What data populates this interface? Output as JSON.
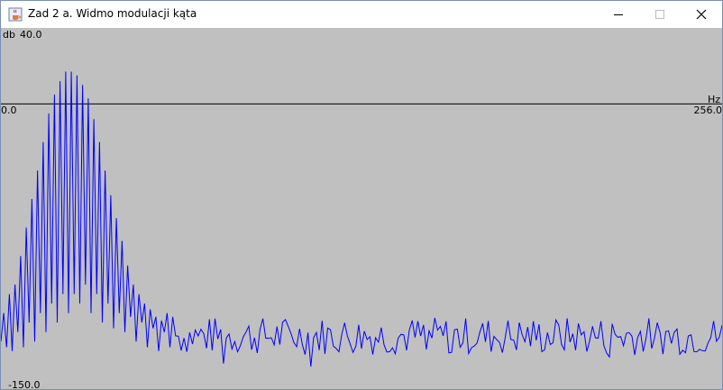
{
  "window": {
    "title": "Zad 2 a. Widmo modulacji kąta",
    "app_icon": "java-cup-icon",
    "controls": [
      "minimize-icon",
      "maximize-icon",
      "close-icon"
    ]
  },
  "chart_data": {
    "type": "line",
    "title": "",
    "ylabel": "db",
    "xlabel": "Hz",
    "y_max_label": "40.0",
    "y_min_label": "-150.0",
    "x_min_label": "0.0",
    "x_max_label": "256.0",
    "xlim": [
      0,
      256
    ],
    "ylim": [
      -150,
      40
    ],
    "grid": false,
    "line_color": "#0000ff",
    "background_color": "#c0c0c0",
    "envelope": {
      "lobe_start_hz": 0,
      "lobe_end_hz": 62,
      "peak_db": 17,
      "trough_db": -125,
      "noise_floor_db": -122,
      "noise_range_db": [
        -132,
        -112
      ]
    },
    "series": [
      {
        "x": [
          0,
          1,
          2,
          3,
          4,
          5,
          6,
          7,
          8,
          9,
          10,
          11,
          12,
          13,
          14,
          15,
          16,
          17,
          18,
          19,
          20,
          21,
          22,
          23,
          24,
          25,
          26,
          27,
          28,
          29,
          30,
          31,
          32,
          33,
          34,
          35,
          36,
          37,
          38,
          39,
          40,
          41,
          42,
          43,
          44,
          45,
          46,
          47,
          48,
          49,
          50,
          51,
          52,
          53,
          54,
          55,
          56,
          57,
          58,
          59,
          60,
          61,
          62
        ],
        "values": [
          -125,
          -110,
          -128,
          -100,
          -130,
          -95,
          -120,
          -80,
          -128,
          -65,
          -115,
          -50,
          -125,
          -35,
          -110,
          -20,
          -120,
          -5,
          -105,
          5,
          -115,
          12,
          -100,
          17,
          -110,
          17,
          -100,
          15,
          -105,
          10,
          -95,
          3,
          -110,
          -8,
          -100,
          -20,
          -115,
          -35,
          -105,
          -48,
          -118,
          -60,
          -110,
          -72,
          -120,
          -85,
          -112,
          -95,
          -125,
          -100,
          -115,
          -105,
          -128,
          -108,
          -118,
          -112,
          -130,
          -114,
          -120,
          -110,
          -128,
          -112,
          -122
        ]
      }
    ]
  }
}
